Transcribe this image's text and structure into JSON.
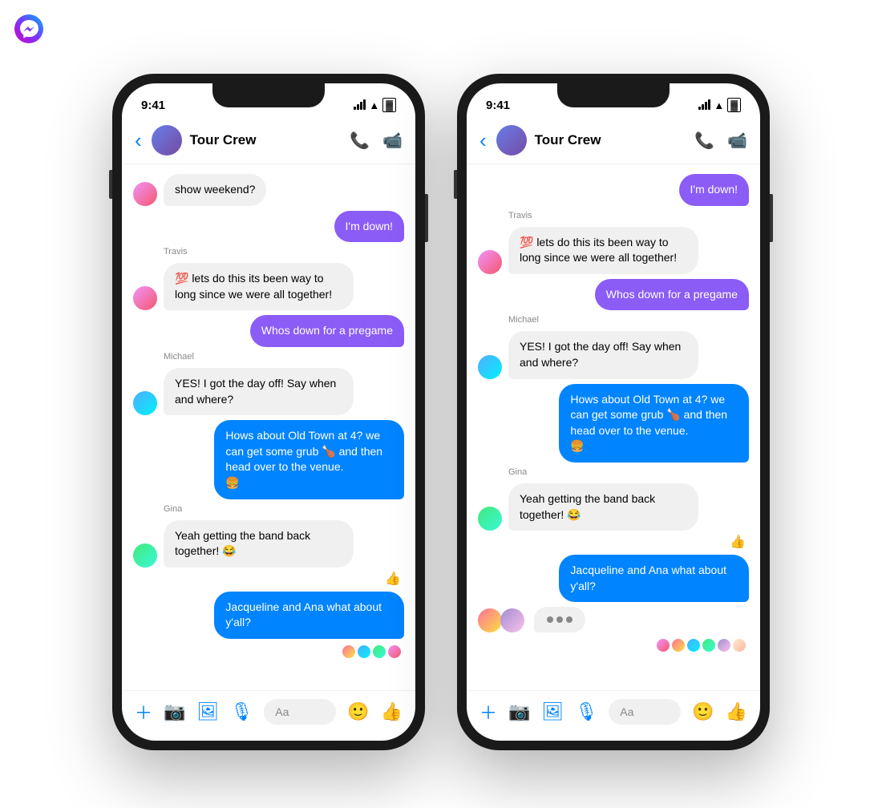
{
  "app": {
    "name": "Facebook Messenger"
  },
  "phone1": {
    "status_time": "9:41",
    "header": {
      "title": "Tour Crew",
      "back_label": "‹",
      "call_icon": "📞",
      "video_icon": "📹"
    },
    "messages": [
      {
        "id": "m0",
        "type": "received",
        "sender": "",
        "text": "show weekend?",
        "avatar": "travis"
      },
      {
        "id": "m1",
        "type": "sent",
        "text": "I'm down!",
        "color": "purple"
      },
      {
        "id": "m1b",
        "type": "sender_name",
        "name": "Travis"
      },
      {
        "id": "m2",
        "type": "received",
        "sender": "travis",
        "text": "💯 lets do this its been way to long since we were all together!",
        "avatar": "travis"
      },
      {
        "id": "m3",
        "type": "sent",
        "text": "Whos down for a pregame",
        "color": "purple"
      },
      {
        "id": "m3b",
        "type": "sender_name",
        "name": "Michael"
      },
      {
        "id": "m4",
        "type": "received",
        "sender": "michael",
        "text": "YES! I got the day off! Say when and where?",
        "avatar": "michael"
      },
      {
        "id": "m5",
        "type": "sent",
        "text": "Hows about Old Town at 4? we can get some grub 🍗 and then head over to the venue.\n🍔",
        "color": "blue"
      },
      {
        "id": "m5b",
        "type": "sender_name",
        "name": "Gina"
      },
      {
        "id": "m6",
        "type": "received",
        "sender": "gina",
        "text": "Yeah getting the band back together! 😂",
        "avatar": "gina"
      },
      {
        "id": "m6r",
        "type": "reaction",
        "emoji": "👍",
        "side": "right"
      },
      {
        "id": "m7",
        "type": "sent",
        "text": "Jacqueline and Ana what about y'all?",
        "color": "blue"
      },
      {
        "id": "m7r",
        "type": "read_receipts",
        "avatars": [
          "user1",
          "user2",
          "user3",
          "user4"
        ]
      }
    ],
    "toolbar": {
      "input_placeholder": "Aa"
    }
  },
  "phone2": {
    "status_time": "9:41",
    "header": {
      "title": "Tour Crew",
      "back_label": "‹",
      "call_icon": "📞",
      "video_icon": "📹"
    },
    "messages": [
      {
        "id": "p2m0",
        "type": "sent",
        "text": "I'm down!",
        "color": "purple"
      },
      {
        "id": "p2m1b",
        "type": "sender_name",
        "name": "Travis"
      },
      {
        "id": "p2m1",
        "type": "received",
        "sender": "travis",
        "text": "💯 lets do this its been way to long since we were all together!",
        "avatar": "travis"
      },
      {
        "id": "p2m2",
        "type": "sent",
        "text": "Whos down for a pregame",
        "color": "purple"
      },
      {
        "id": "p2m2b",
        "type": "sender_name",
        "name": "Michael"
      },
      {
        "id": "p2m3",
        "type": "received",
        "sender": "michael",
        "text": "YES! I got the day off! Say when and where?",
        "avatar": "michael"
      },
      {
        "id": "p2m4",
        "type": "sent",
        "text": "Hows about Old Town at 4? we can get some grub 🍗 and then head over to the venue.\n🍔",
        "color": "blue"
      },
      {
        "id": "p2m4b",
        "type": "sender_name",
        "name": "Gina"
      },
      {
        "id": "p2m5",
        "type": "received",
        "sender": "gina",
        "text": "Yeah getting the band back together! 😂",
        "avatar": "gina"
      },
      {
        "id": "p2m5r",
        "type": "reaction",
        "emoji": "👍",
        "side": "right"
      },
      {
        "id": "p2m6",
        "type": "sent",
        "text": "Jacqueline and Ana what about y'all?",
        "color": "blue"
      },
      {
        "id": "p2m7",
        "type": "typing",
        "avatars": [
          "user1",
          "user2"
        ]
      },
      {
        "id": "p2m7r",
        "type": "read_receipts",
        "avatars": [
          "user1",
          "user2",
          "user3",
          "user4",
          "user5",
          "user6"
        ]
      }
    ],
    "toolbar": {
      "input_placeholder": "Aa"
    }
  }
}
